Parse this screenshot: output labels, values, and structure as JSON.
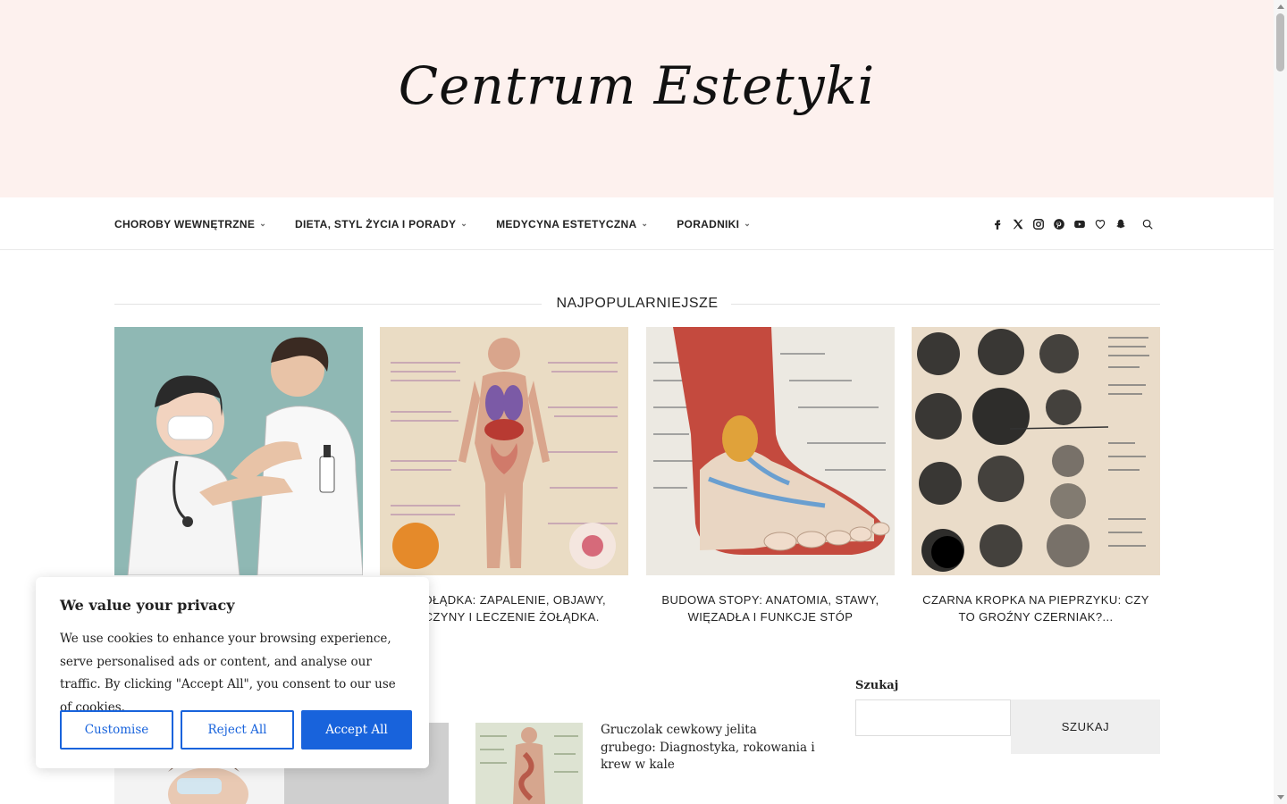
{
  "site": {
    "logo_text": "Centrum Estetyki"
  },
  "nav": {
    "items": [
      {
        "label": "CHOROBY WEWNĘTRZNE"
      },
      {
        "label": "DIETA, STYL ŻYCIA I PORADY"
      },
      {
        "label": "MEDYCYNA ESTETYCZNA"
      },
      {
        "label": "PORADNIKI"
      }
    ],
    "social_icons": [
      "facebook-icon",
      "x-twitter-icon",
      "instagram-icon",
      "pinterest-icon",
      "youtube-icon",
      "bloglovin-heart-icon",
      "snapchat-icon"
    ],
    "search_icon": "search-icon"
  },
  "popular": {
    "heading": "NAJPOPULARNIEJSZE",
    "cards": [
      {
        "title": "",
        "image": "doctor-examining-patient-illustration"
      },
      {
        "title": "M ŻOŁĄDKA: ZAPALENIE, OBJAWY, ZYCZYNY I LECZENIE ŻOŁĄDKA.",
        "image": "human-anatomy-chart"
      },
      {
        "title": "BUDOWA STOPY: ANATOMIA, STAWY, WIĘZADŁA I FUNKCJE STÓP",
        "image": "foot-anatomy-illustration"
      },
      {
        "title": "CZARNA KROPKA NA PIEPRZYKU: CZY TO GROŹNY CZERNIAK?...",
        "image": "black-dots-mole-chart"
      }
    ]
  },
  "latest": {
    "item_title": "Gruczolak cewkowy jelita grubego: Diagnostyka, rokowania i krew w kale"
  },
  "sidebar": {
    "search_title": "Szukaj",
    "search_placeholder": "",
    "search_button": "SZUKAJ"
  },
  "cookie_banner": {
    "title": "We value your privacy",
    "text": "We use cookies to enhance your browsing experience, serve personalised ads or content, and analyse our traffic. By clicking \"Accept All\", you consent to our use of cookies.",
    "customise": "Customise",
    "reject": "Reject All",
    "accept": "Accept All",
    "accent_color": "#1863dc"
  },
  "colors": {
    "masthead_bg": "#fdf1ee",
    "text": "#222222"
  }
}
